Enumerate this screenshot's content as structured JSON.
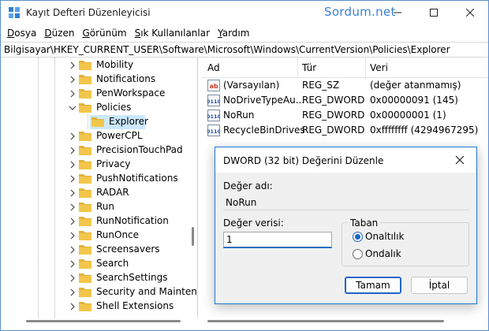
{
  "window": {
    "title": "Kayıt Defteri Düzenleyicisi",
    "watermark": "Sordum.net"
  },
  "menu": [
    {
      "prefix": "",
      "key": "D",
      "rest": "osya"
    },
    {
      "prefix": "",
      "key": "D",
      "rest": "üzen"
    },
    {
      "prefix": "",
      "key": "G",
      "rest": "örünüm"
    },
    {
      "prefix": "",
      "key": "S",
      "rest": "ık Kullanılanlar"
    },
    {
      "prefix": "",
      "key": "Y",
      "rest": "ardım"
    }
  ],
  "address": "Bilgisayar\\HKEY_CURRENT_USER\\Software\\Microsoft\\Windows\\CurrentVersion\\Policies\\Explorer",
  "tree": {
    "items": [
      {
        "label": "Mobility",
        "chevron": "right",
        "indent": 0
      },
      {
        "label": "Notifications",
        "chevron": "right",
        "indent": 0
      },
      {
        "label": "PenWorkspace",
        "chevron": "right",
        "indent": 0
      },
      {
        "label": "Policies",
        "chevron": "down",
        "indent": 0
      },
      {
        "label": "Explorer",
        "chevron": "none",
        "indent": 1,
        "selected": true
      },
      {
        "label": "PowerCPL",
        "chevron": "right",
        "indent": 0
      },
      {
        "label": "PrecisionTouchPad",
        "chevron": "right",
        "indent": 0
      },
      {
        "label": "Privacy",
        "chevron": "right",
        "indent": 0
      },
      {
        "label": "PushNotifications",
        "chevron": "right",
        "indent": 0
      },
      {
        "label": "RADAR",
        "chevron": "right",
        "indent": 0
      },
      {
        "label": "Run",
        "chevron": "right",
        "indent": 0
      },
      {
        "label": "RunNotification",
        "chevron": "right",
        "indent": 0
      },
      {
        "label": "RunOnce",
        "chevron": "right",
        "indent": 0
      },
      {
        "label": "Screensavers",
        "chevron": "right",
        "indent": 0
      },
      {
        "label": "Search",
        "chevron": "right",
        "indent": 0
      },
      {
        "label": "SearchSettings",
        "chevron": "right",
        "indent": 0
      },
      {
        "label": "Security and Mainten",
        "chevron": "right",
        "indent": 0
      },
      {
        "label": "Shell Extensions",
        "chevron": "right",
        "indent": 0
      }
    ]
  },
  "list": {
    "columns": [
      "Ad",
      "Tür",
      "Veri"
    ],
    "rows": [
      {
        "icon": "string-value-icon",
        "name": "(Varsayılan)",
        "type": "REG_SZ",
        "data": "(değer atanmamış)"
      },
      {
        "icon": "binary-value-icon",
        "name": "NoDriveTypeAu...",
        "type": "REG_DWORD",
        "data": "0x00000091 (145)"
      },
      {
        "icon": "binary-value-icon",
        "name": "NoRun",
        "type": "REG_DWORD",
        "data": "0x00000001 (1)"
      },
      {
        "icon": "binary-value-icon",
        "name": "RecycleBinDrives",
        "type": "REG_DWORD",
        "data": "0xffffffff (4294967295)"
      }
    ]
  },
  "dialog": {
    "title": "DWORD (32 bit) Değerini Düzenle",
    "name_label": "Değer adı:",
    "name_value": "NoRun",
    "data_label": "Değer verisi:",
    "data_value": "1",
    "base_label": "Taban",
    "base_options": [
      "Onaltılık",
      "Ondalık"
    ],
    "base_selected": "Onaltılık",
    "ok_label": "Tamam",
    "cancel_label": "İptal"
  },
  "colors": {
    "accent": "#1a66c4",
    "folder": "#f3c64b",
    "selection": "#cce8ff"
  }
}
